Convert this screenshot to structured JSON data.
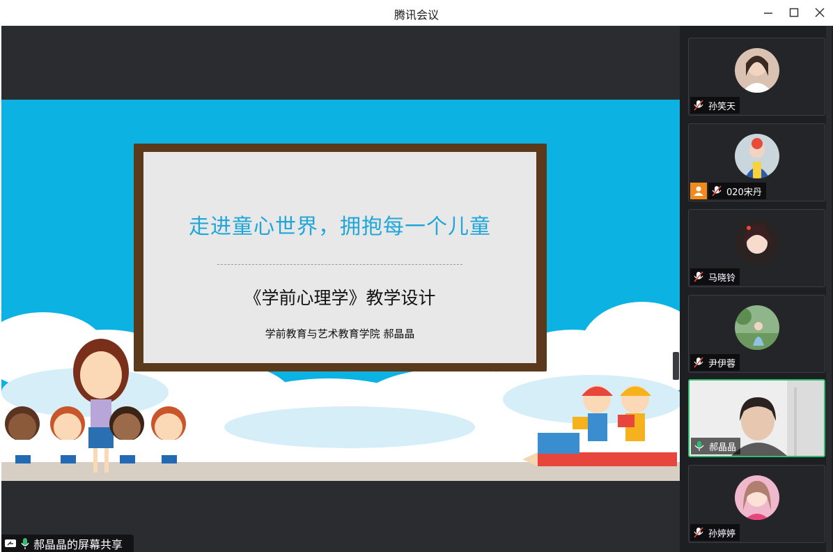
{
  "window": {
    "title": "腾讯会议"
  },
  "slide": {
    "title": "走进童心世界，拥抱每一个儿童",
    "subtitle": "《学前心理学》教学设计",
    "author": "学前教育与艺术教育学院  郝晶晶"
  },
  "share": {
    "label": "郝晶晶的屏幕共享"
  },
  "participants": [
    {
      "name": "孙笑天",
      "mic": "muted"
    },
    {
      "name": "020宋丹",
      "mic": "muted",
      "host_icon": "person-icon"
    },
    {
      "name": "马晓铃",
      "mic": "muted"
    },
    {
      "name": "尹伊蓉",
      "mic": "muted"
    },
    {
      "name": "郝晶晶",
      "mic": "on",
      "speaking": true
    },
    {
      "name": "孙婷婷",
      "mic": "muted"
    }
  ],
  "colors": {
    "accent_green": "#2fbf71",
    "slide_blue": "#0cb2e2",
    "title_blue": "#21a6d8",
    "host_orange": "#f08a1c"
  }
}
